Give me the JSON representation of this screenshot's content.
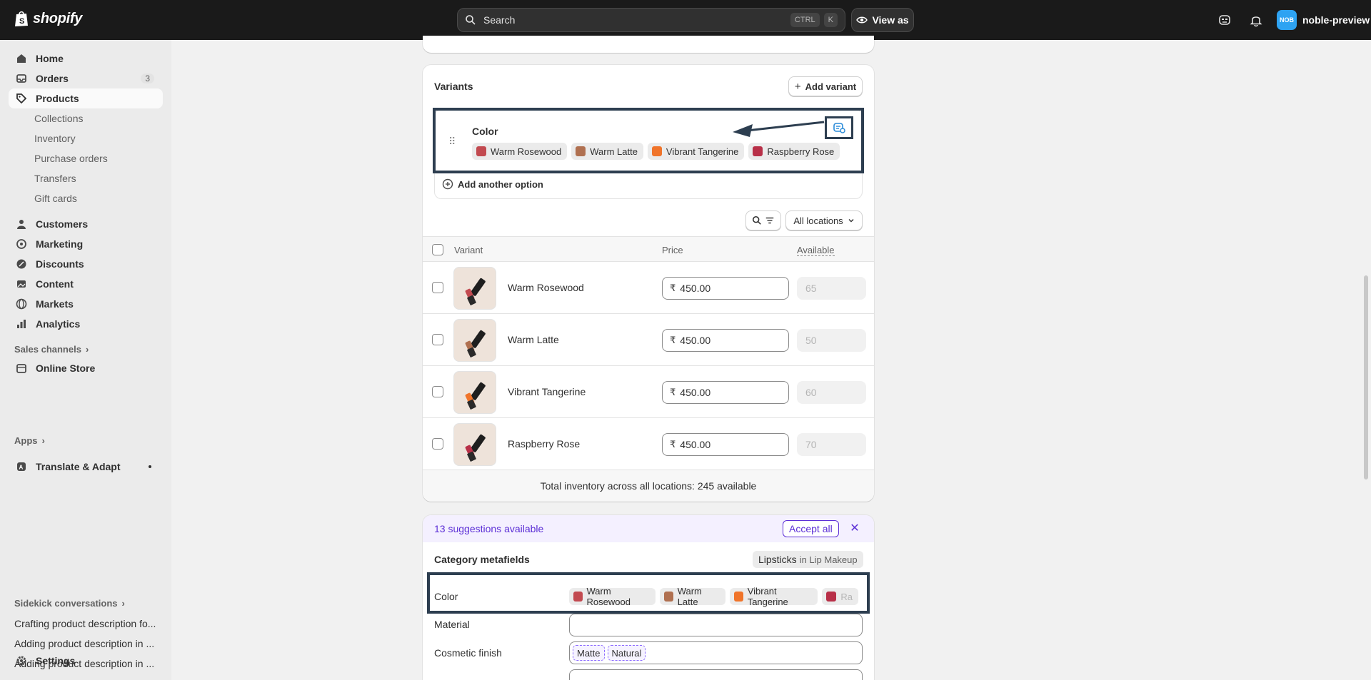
{
  "topbar": {
    "brand": "shopify",
    "search_placeholder": "Search",
    "kbd_ctrl": "CTRL",
    "kbd_k": "K",
    "view_as": "View as",
    "avatar_initials": "NOB",
    "store_name": "noble-preview"
  },
  "sidebar": {
    "home": "Home",
    "orders": "Orders",
    "orders_badge": "3",
    "products": "Products",
    "collections": "Collections",
    "inventory": "Inventory",
    "purchase_orders": "Purchase orders",
    "transfers": "Transfers",
    "gift_cards": "Gift cards",
    "customers": "Customers",
    "marketing": "Marketing",
    "discounts": "Discounts",
    "content": "Content",
    "markets": "Markets",
    "analytics": "Analytics",
    "sales_channels": "Sales channels",
    "online_store": "Online Store",
    "apps": "Apps",
    "translate": "Translate & Adapt",
    "sidekick": "Sidekick conversations",
    "conversations": [
      "Crafting product description fo...",
      "Adding product description in ...",
      "Adding product description in ..."
    ],
    "settings": "Settings"
  },
  "variants": {
    "title": "Variants",
    "add_variant": "Add variant",
    "option_name": "Color",
    "option_values": [
      {
        "label": "Warm Rosewood",
        "color": "#c24a50"
      },
      {
        "label": "Warm Latte",
        "color": "#b07050"
      },
      {
        "label": "Vibrant Tangerine",
        "color": "#f0742a"
      },
      {
        "label": "Raspberry Rose",
        "color": "#b83048"
      }
    ],
    "add_option": "Add another option",
    "locations": "All locations",
    "col_variant": "Variant",
    "col_price": "Price",
    "col_available": "Available",
    "rows": [
      {
        "name": "Warm Rosewood",
        "currency": "₹",
        "price": "450.00",
        "available": "65"
      },
      {
        "name": "Warm Latte",
        "currency": "₹",
        "price": "450.00",
        "available": "50"
      },
      {
        "name": "Vibrant Tangerine",
        "currency": "₹",
        "price": "450.00",
        "available": "60"
      },
      {
        "name": "Raspberry Rose",
        "currency": "₹",
        "price": "450.00",
        "available": "70"
      }
    ],
    "total": "Total inventory across all locations: 245 available"
  },
  "metafields": {
    "suggestions": "13 suggestions available",
    "accept_all": "Accept all",
    "title": "Category metafields",
    "category": "Lipsticks",
    "category_in": "in Lip Makeup",
    "color_label": "Color",
    "color_values": [
      "Warm Rosewood",
      "Warm Latte",
      "Vibrant Tangerine",
      "Ra"
    ],
    "material_label": "Material",
    "finish_label": "Cosmetic finish",
    "finish_values": [
      "Matte",
      "Natural"
    ]
  }
}
